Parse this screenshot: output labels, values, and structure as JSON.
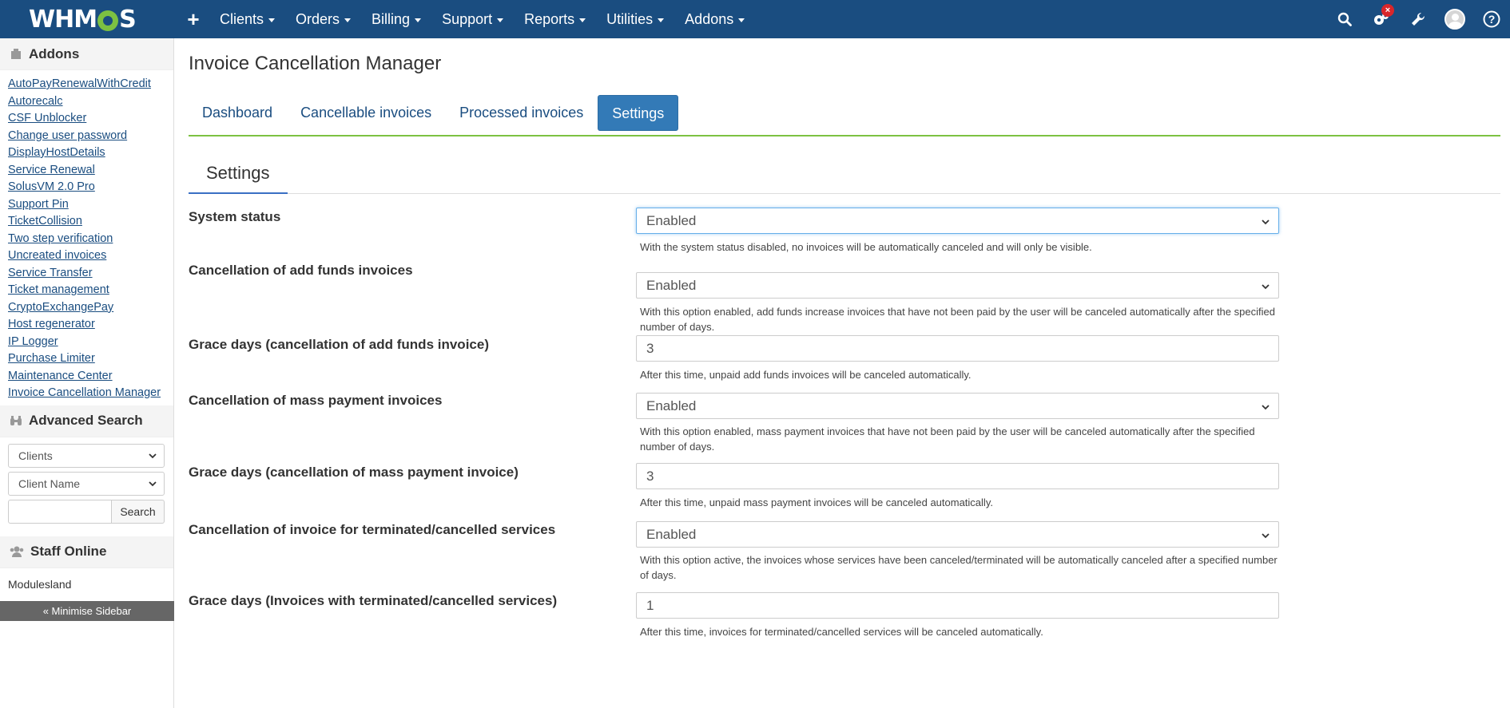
{
  "topbar": {
    "logo": "WHMCS",
    "nav": [
      "Clients",
      "Orders",
      "Billing",
      "Support",
      "Reports",
      "Utilities",
      "Addons"
    ],
    "notification_count": "×"
  },
  "sidebar": {
    "addons_title": "Addons",
    "addons": [
      "AutoPayRenewalWithCredit",
      "Autorecalc",
      "CSF Unblocker",
      "Change user password",
      "DisplayHostDetails",
      "Service Renewal",
      "SolusVM 2.0 Pro",
      "Support Pin",
      "TicketCollision",
      "Two step verification",
      "Uncreated invoices",
      "Service Transfer",
      "Ticket management",
      "CryptoExchangePay",
      "Host regenerator",
      "IP Logger",
      "Purchase Limiter",
      "Maintenance Center",
      "Invoice Cancellation Manager"
    ],
    "search_title": "Advanced Search",
    "search_type": "Clients",
    "search_field": "Client Name",
    "search_value": "",
    "search_button": "Search",
    "staff_title": "Staff Online",
    "staff": "Modulesland",
    "minimise": "« Minimise Sidebar"
  },
  "main": {
    "title": "Invoice Cancellation Manager",
    "tabs": [
      "Dashboard",
      "Cancellable invoices",
      "Processed invoices",
      "Settings"
    ],
    "active_tab": "Settings",
    "section_tab": "Settings",
    "rows": [
      {
        "label": "System status",
        "value": "Enabled",
        "help": "With the system status disabled, no invoices will be automatically canceled and will only be visible."
      },
      {
        "label": "Cancellation of add funds invoices",
        "value": "Enabled",
        "help": "With this option enabled, add funds increase invoices that have not been paid by the user will be canceled automatically after the specified number of days."
      },
      {
        "label": "Grace days (cancellation of add funds invoice)",
        "value": "3",
        "help": "After this time, unpaid add funds invoices will be canceled automatically."
      },
      {
        "label": "Cancellation of mass payment invoices",
        "value": "Enabled",
        "help": "With this option enabled, mass payment invoices that have not been paid by the user will be canceled automatically after the specified number of days."
      },
      {
        "label": "Grace days (cancellation of mass payment invoice)",
        "value": "3",
        "help": "After this time, unpaid mass payment invoices will be canceled automatically."
      },
      {
        "label": "Cancellation of invoice for terminated/cancelled services",
        "value": "Enabled",
        "help": "With this option active, the invoices whose services have been canceled/terminated will be automatically canceled after a specified number of days."
      },
      {
        "label": "Grace days (Invoices with terminated/cancelled services)",
        "value": "1",
        "help": "After this time, invoices for terminated/cancelled services will be canceled automatically."
      }
    ]
  }
}
